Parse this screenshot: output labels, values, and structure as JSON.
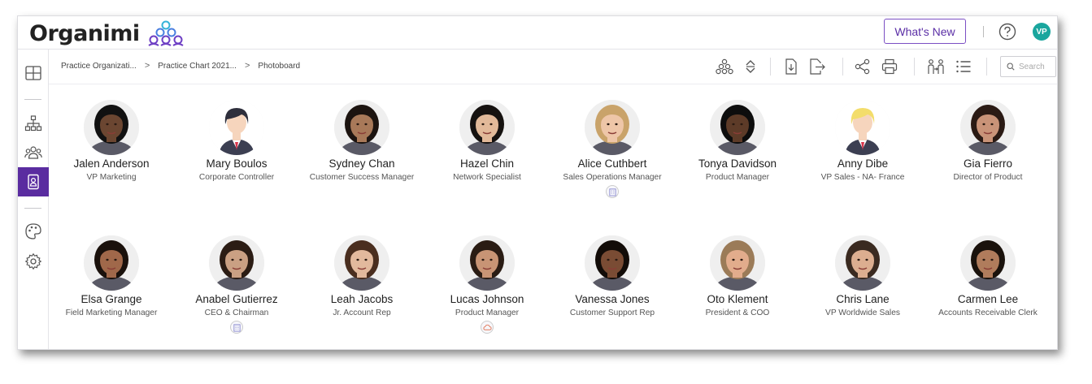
{
  "app": {
    "logo_text": "Organimi",
    "whats_new": "What's New",
    "avatar_initials": "VP"
  },
  "breadcrumb": {
    "items": [
      "Practice Organizati...",
      "Practice Chart 2021...",
      "Photoboard"
    ],
    "separator": ">"
  },
  "search": {
    "placeholder": "Search"
  },
  "colors": {
    "brand": "#5a2ca0",
    "accent": "#7b4fc4",
    "avatar": "#1aa69e"
  },
  "people": [
    {
      "name": "Jalen Anderson",
      "title": "VP Marketing",
      "skin": "#6b4631",
      "hair": "#111111",
      "badge": ""
    },
    {
      "name": "Mary Boulos",
      "title": "Corporate Controller",
      "skin": "#f6d5bd",
      "hair": "#2e2f3c",
      "badge": "",
      "illustrated": true
    },
    {
      "name": "Sydney Chan",
      "title": "Customer Success Manager",
      "skin": "#a87959",
      "hair": "#1c1410",
      "badge": ""
    },
    {
      "name": "Hazel Chin",
      "title": "Network Specialist",
      "skin": "#e2b999",
      "hair": "#161210",
      "badge": ""
    },
    {
      "name": "Alice Cuthbert",
      "title": "Sales Operations Manager",
      "skin": "#eec6a8",
      "hair": "#c9a36a",
      "badge": "building-icon"
    },
    {
      "name": "Tonya Davidson",
      "title": "Product Manager",
      "skin": "#5d3b28",
      "hair": "#0d0d0d",
      "badge": ""
    },
    {
      "name": "Anny Dibe",
      "title": "VP Sales - NA- France",
      "skin": "#f6d5bd",
      "hair": "#f3dd6b",
      "badge": "",
      "illustrated": true
    },
    {
      "name": "Gia Fierro",
      "title": "Director of Product",
      "skin": "#c99378",
      "hair": "#2a1a14",
      "badge": ""
    },
    {
      "name": "Elsa Grange",
      "title": "Field Marketing Manager",
      "skin": "#a0684a",
      "hair": "#1a110c",
      "badge": ""
    },
    {
      "name": "Anabel Gutierrez",
      "title": "CEO & Chairman",
      "skin": "#caa083",
      "hair": "#2b1c14",
      "badge": "building-icon"
    },
    {
      "name": "Leah Jacobs",
      "title": "Jr. Account Rep",
      "skin": "#e2b99d",
      "hair": "#4a2e1f",
      "badge": ""
    },
    {
      "name": "Lucas Johnson",
      "title": "Product Manager",
      "skin": "#c89475",
      "hair": "#2a1c14",
      "badge": "cloud-icon"
    },
    {
      "name": "Vanessa Jones",
      "title": "Customer Support Rep",
      "skin": "#7a4c34",
      "hair": "#120c08",
      "badge": ""
    },
    {
      "name": "Oto Klement",
      "title": "President & COO",
      "skin": "#e2ac8c",
      "hair": "#9b7b58",
      "badge": ""
    },
    {
      "name": "Chris Lane",
      "title": "VP Worldwide Sales",
      "skin": "#dcae90",
      "hair": "#3a2a20",
      "badge": ""
    },
    {
      "name": "Carmen Lee",
      "title": "Accounts Receivable Clerk",
      "skin": "#b07c5c",
      "hair": "#1a120c",
      "badge": ""
    }
  ]
}
